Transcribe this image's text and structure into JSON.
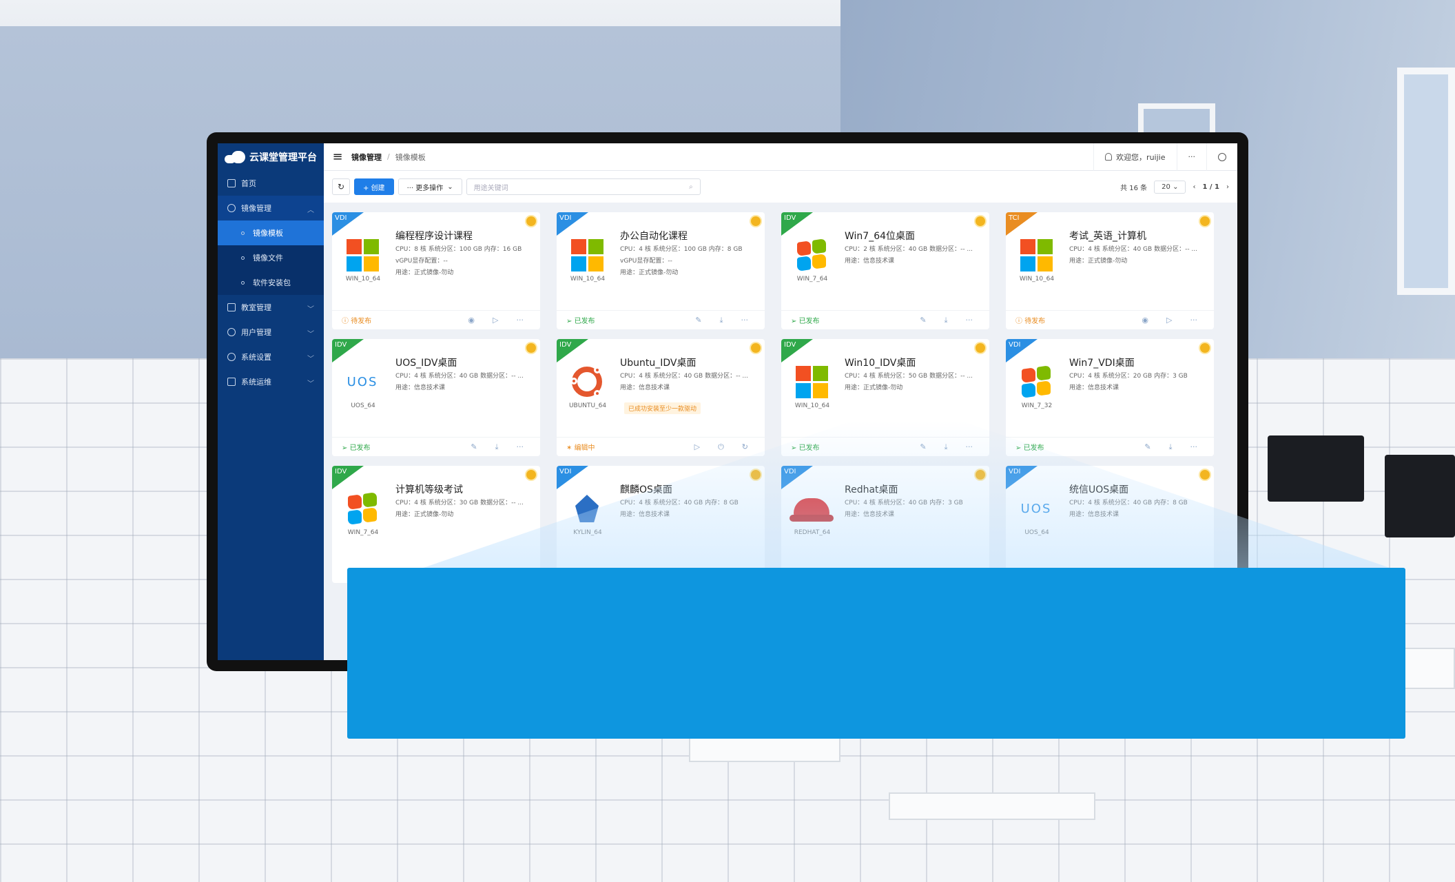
{
  "app": {
    "logo_text": "云课堂管理平台"
  },
  "sidebar": {
    "items": [
      {
        "label": "首页",
        "icon": "home-icon"
      },
      {
        "label": "镜像管理",
        "icon": "disc-icon",
        "expanded": true,
        "children": [
          {
            "label": "镜像模板",
            "active": true
          },
          {
            "label": "镜像文件"
          },
          {
            "label": "软件安装包"
          }
        ]
      },
      {
        "label": "教室管理",
        "icon": "classroom-icon"
      },
      {
        "label": "用户管理",
        "icon": "user-icon"
      },
      {
        "label": "系统设置",
        "icon": "settings-icon"
      },
      {
        "label": "系统运维",
        "icon": "tools-icon"
      }
    ]
  },
  "header": {
    "breadcrumb": [
      "镜像管理",
      "镜像模板"
    ],
    "welcome": "欢迎您，ruijie",
    "more": "···"
  },
  "toolbar": {
    "create_label": "+ 创建",
    "more_label": "··· 更多操作",
    "search_placeholder": "用途关键词",
    "total": "共 16 条",
    "page_size": "20",
    "page": "1 / 1"
  },
  "cards": [
    {
      "type": "VDI",
      "title": "编程程序设计课程",
      "os": "WIN_10_64",
      "icon": "win10",
      "line1": "CPU：8 核    系统分区：100 GB    内存：16 GB",
      "line2": "vGPU显存配置：--",
      "line3": "用途：正式镜像-勿动",
      "status": "待发布",
      "state": "wait"
    },
    {
      "type": "VDI",
      "title": "办公自动化课程",
      "os": "WIN_10_64",
      "icon": "win10",
      "line1": "CPU：4 核    系统分区：100 GB    内存：8 GB",
      "line2": "vGPU显存配置：--",
      "line3": "用途：正式镜像-勿动",
      "status": "已发布",
      "state": "ok"
    },
    {
      "type": "IDV",
      "title": "Win7_64位桌面",
      "os": "WIN_7_64",
      "icon": "win7",
      "line1": "CPU：2 核    系统分区：40 GB    数据分区：-- ...",
      "line2": "用途：信息技术课",
      "line3": "",
      "status": "已发布",
      "state": "ok"
    },
    {
      "type": "TCI",
      "title": "考试_英语_计算机",
      "os": "WIN_10_64",
      "icon": "win10",
      "line1": "CPU：4 核    系统分区：40 GB    数据分区：-- ...",
      "line2": "用途：正式镜像-勿动",
      "line3": "",
      "status": "待发布",
      "state": "wait"
    },
    {
      "type": "IDV",
      "title": "UOS_IDV桌面",
      "os": "UOS_64",
      "icon": "uos",
      "line1": "CPU：4 核    系统分区：40 GB    数据分区：-- ...",
      "line2": "用途：信息技术课",
      "line3": "",
      "status": "已发布",
      "state": "ok"
    },
    {
      "type": "IDV",
      "title": "Ubuntu_IDV桌面",
      "os": "UBUNTU_64",
      "icon": "ubuntu",
      "line1": "CPU：4 核    系统分区：40 GB    数据分区：-- ...",
      "line2": "用途：信息技术课",
      "line3": "",
      "tag": "已成功安装至少一款驱动",
      "status": "编辑中",
      "state": "edit"
    },
    {
      "type": "IDV",
      "title": "Win10_IDV桌面",
      "os": "WIN_10_64",
      "icon": "win10",
      "line1": "CPU：4 核    系统分区：50 GB    数据分区：-- ...",
      "line2": "用途：正式镜像-勿动",
      "line3": "",
      "status": "已发布",
      "state": "ok"
    },
    {
      "type": "VDI",
      "title": "Win7_VDI桌面",
      "os": "WIN_7_32",
      "icon": "win7",
      "line1": "CPU：4 核    系统分区：20 GB    内存：3 GB",
      "line2": "用途：信息技术课",
      "line3": "",
      "status": "已发布",
      "state": "ok"
    },
    {
      "type": "IDV",
      "title": "计算机等级考试",
      "os": "WIN_7_64",
      "icon": "win7",
      "line1": "CPU：4 核    系统分区：30 GB    数据分区：-- ...",
      "line2": "用途：正式镜像-勿动",
      "line3": "",
      "status": "",
      "state": ""
    },
    {
      "type": "VDI",
      "title": "麒麟OS桌面",
      "os": "KYLIN_64",
      "icon": "kylin",
      "line1": "CPU：4 核    系统分区：40 GB    内存：8 GB",
      "line2": "用途：信息技术课",
      "line3": "",
      "status": "",
      "state": ""
    },
    {
      "type": "VDI",
      "title": "Redhat桌面",
      "os": "REDHAT_64",
      "icon": "redhat",
      "line1": "CPU：4 核    系统分区：40 GB    内存：3 GB",
      "line2": "用途：信息技术课",
      "line3": "",
      "status": "",
      "state": ""
    },
    {
      "type": "VDI",
      "title": "统信UOS桌面",
      "os": "UOS_64",
      "icon": "uos",
      "line1": "CPU：4 核    系统分区：40 GB    内存：8 GB",
      "line2": "用途：信息技术课",
      "line3": "",
      "status": "",
      "state": ""
    }
  ],
  "colors": {
    "sidebar": "#0b3a7a",
    "accent": "#1f7ee8",
    "vdi": "#2b8fe3",
    "idv": "#2fa84a",
    "tci": "#e98d22",
    "banner": "#0e96df"
  }
}
